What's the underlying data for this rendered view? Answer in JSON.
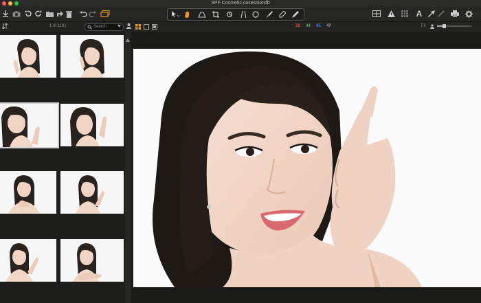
{
  "window": {
    "title": "SPF Cosmetic.cosessiondb",
    "traffic_colors": [
      "#ff5f56",
      "#ffbd2e",
      "#27c93f"
    ]
  },
  "toolbar": {
    "left_icons": [
      "import-icon",
      "camera-icon",
      "rotate-left-icon",
      "rotate-right-icon",
      "folder-icon",
      "share-icon",
      "trash-icon",
      "undo-icon",
      "redo-icon",
      "stack-icon"
    ],
    "cursor_tools": [
      "select-tool-icon",
      "hand-tool-icon",
      "straighten-tool-icon",
      "crop-tool-icon",
      "rotate-tool-icon",
      "keystone-tool-icon",
      "spot-remove-icon",
      "brush-icon",
      "color-picker-icon",
      "annotate-icon"
    ],
    "right_icons": [
      "grid-icon",
      "warning-icon",
      "exposure-warning-icon",
      "text-icon",
      "cursor-arrow-icon",
      "pen-icon",
      "print-icon",
      "settings-icon"
    ]
  },
  "browser": {
    "counter": "1 of 1101",
    "search_placeholder": "Search",
    "view_modes": [
      "grid-view-icon",
      "single-view-icon",
      "compare-view-icon"
    ]
  },
  "stats": {
    "values": [
      "52",
      "44",
      "45",
      "47"
    ],
    "colors": [
      "#e04a4a",
      "#5ab24a",
      "#4a7ae0",
      "#aaaaaa"
    ]
  },
  "fit_label": "Fit",
  "accent": "#e39a2a"
}
